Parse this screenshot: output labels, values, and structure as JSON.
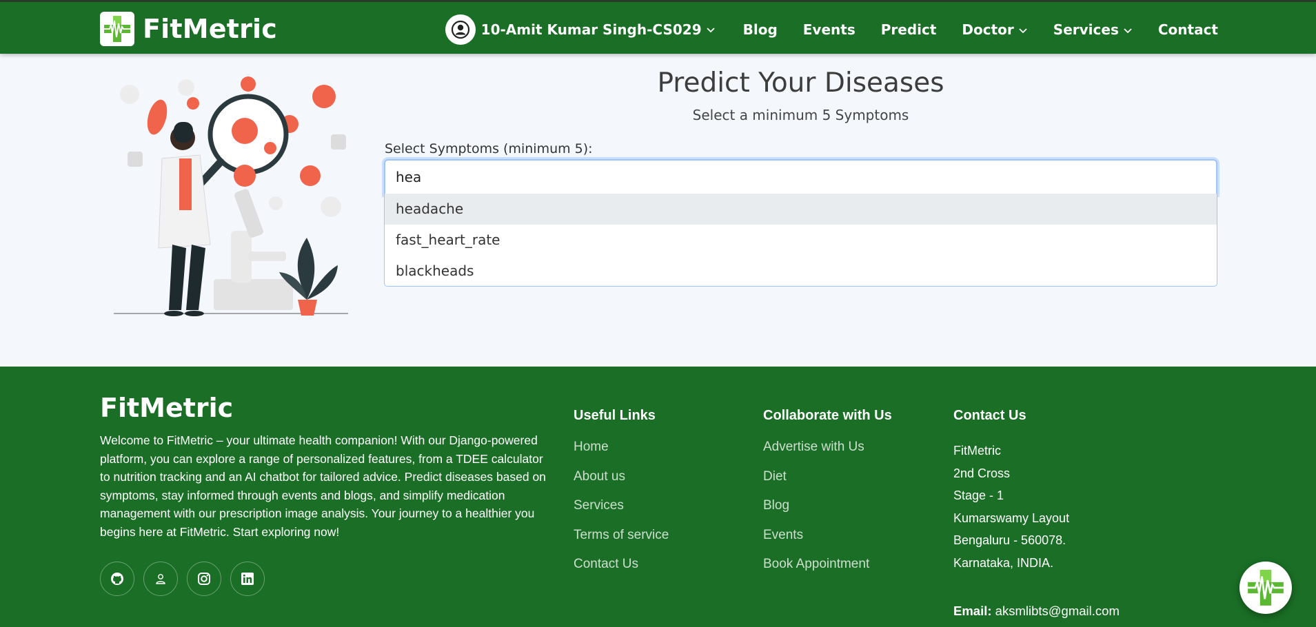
{
  "header": {
    "brand": "FitMetric",
    "user": "10-Amit Kumar Singh-CS029",
    "nav": [
      "Blog",
      "Events",
      "Predict",
      "Doctor",
      "Services",
      "Contact"
    ]
  },
  "main": {
    "title": "Predict Your Diseases",
    "subtitle": "Select a minimum 5 Symptoms",
    "field_label": "Select Symptoms (minimum 5):",
    "search_value": "hea",
    "suggestions": [
      "headache",
      "fast_heart_rate",
      "blackheads"
    ]
  },
  "footer": {
    "brand": "FitMetric",
    "description": "Welcome to FitMetric – your ultimate health companion! With our Django-powered platform, you can explore a range of personalized features, from a TDEE calculator to nutrition tracking and an AI chatbot for tailored advice. Predict diseases based on symptoms, stay informed through events and blogs, and simplify medication management with our prescription image analysis. Your journey to a healthier you begins here at FitMetric. Start exploring now!",
    "useful_links": {
      "heading": "Useful Links",
      "items": [
        "Home",
        "About us",
        "Services",
        "Terms of service",
        "Contact Us"
      ]
    },
    "collaborate": {
      "heading": "Collaborate with Us",
      "items": [
        "Advertise with Us",
        "Diet",
        "Blog",
        "Events",
        "Book Appointment"
      ]
    },
    "contact": {
      "heading": "Contact Us",
      "lines": [
        "FitMetric",
        "2nd Cross",
        "Stage - 1",
        "Kumarswamy Layout",
        "Bengaluru - 560078.",
        "Karnataka, INDIA."
      ],
      "email_label": "Email:",
      "email": "aksmlibts@gmail.com"
    },
    "socials": [
      "github-icon",
      "user-icon",
      "instagram-icon",
      "linkedin-icon"
    ]
  },
  "colors": {
    "primary_green": "#1a6e25",
    "page_bg": "#f4f8fd",
    "focus_blue": "#9ec5f6",
    "illustration_accent": "#f0644c"
  }
}
